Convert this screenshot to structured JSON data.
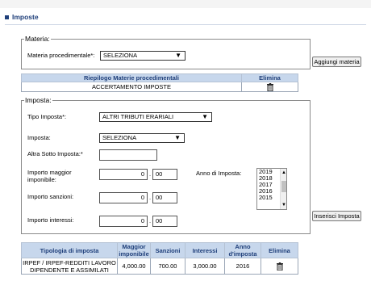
{
  "section": {
    "title": "Imposte"
  },
  "materia": {
    "legend": "Materia:",
    "label": "Materia procedimentale*:",
    "select_value": "SELEZIONA",
    "add_button": "Aggiungi materia"
  },
  "riepilogo": {
    "headers": [
      "Riepilogo Materie procedimentali",
      "Elimina"
    ],
    "rows": [
      {
        "materia": "ACCERTAMENTO IMPOSTE"
      }
    ]
  },
  "imposta": {
    "legend": "Imposta:",
    "tipo_label": "Tipo Imposta*:",
    "tipo_value": "ALTRI TRIBUTI ERARIALI",
    "imposta_label": "Imposta:",
    "imposta_value": "SELEZIONA",
    "sotto_label": "Altra Sotto Imposta:*",
    "sotto_value": "",
    "maggiore_label_1": "Importo maggior",
    "maggiore_label_2": "imponibile:",
    "maggiore_int": "0",
    "maggiore_dec": "00",
    "sanzioni_label": "Importo sanzioni:",
    "sanzioni_int": "0",
    "sanzioni_dec": "00",
    "interessi_label": "Importo interessi:",
    "interessi_int": "0",
    "interessi_dec": "00",
    "anno_label": "Anno di Imposta:",
    "years": [
      "2019",
      "2018",
      "2017",
      "2016",
      "2015"
    ],
    "insert_button": "Inserisci Imposta"
  },
  "summary": {
    "headers": [
      "Tipologia di imposta",
      "Maggior imponibile",
      "Sanzioni",
      "Interessi",
      "Anno d'imposta",
      "Elimina"
    ],
    "rows": [
      {
        "tipologia": "IRPEF / IRPEF-REDDITI LAVORO DIPENDENTE E ASSIMILATI",
        "maggior_imponibile": "4,000.00",
        "sanzioni": "700.00",
        "interessi": "3,000.00",
        "anno": "2016"
      }
    ]
  },
  "colors": {
    "header_bg": "#c7d7ec",
    "header_text": "#1f3f7a",
    "accent": "#1f3f7a"
  },
  "icons": {
    "delete": "trash-icon",
    "dropdown": "chevron-down-icon"
  }
}
